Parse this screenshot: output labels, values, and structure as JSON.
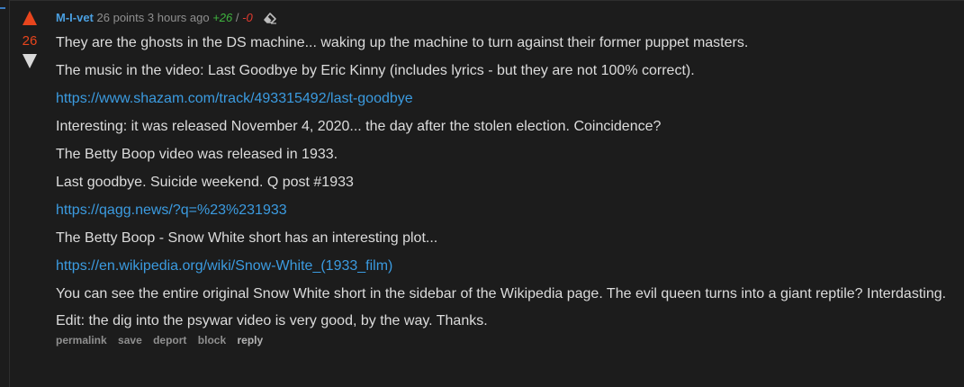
{
  "comment": {
    "author": "M-I-vet",
    "points": "26 points",
    "time": "3 hours ago",
    "upvotes": "+26",
    "separator": "/",
    "downvotes": "-0",
    "score": "26",
    "paragraphs": {
      "p1": "They are the ghosts in the DS machine... waking up the machine to turn against their former puppet masters.",
      "p2": "The music in the video: Last Goodbye by Eric Kinny (includes lyrics - but they are not 100% correct).",
      "link1": "https://www.shazam.com/track/493315492/last-goodbye",
      "p3": "Interesting: it was released November 4, 2020... the day after the stolen election. Coincidence?",
      "p4": "The Betty Boop video was released in 1933.",
      "p5": "Last goodbye. Suicide weekend. Q post #1933",
      "link2": "https://qagg.news/?q=%23%231933",
      "p6": "The Betty Boop - Snow White short has an interesting plot...",
      "link3": "https://en.wikipedia.org/wiki/Snow-White_(1933_film)",
      "p7": "You can see the entire original Snow White short in the sidebar of the Wikipedia page. The evil queen turns into a giant reptile? Interdasting.",
      "p8": "Edit: the dig into the psywar video is very good, by the way. Thanks."
    },
    "buttons": {
      "permalink": "permalink",
      "save": "save",
      "deport": "deport",
      "block": "block",
      "reply": "reply"
    }
  },
  "colors": {
    "background": "#1c1c1c",
    "upvote": "#e8451d",
    "author": "#4a9fe0",
    "link": "#3b9be0",
    "positive": "#3fb43f",
    "negative": "#e13b2f"
  },
  "icons": {
    "upvote": "upvote-arrow-icon",
    "downvote": "downvote-arrow-icon",
    "eraser": "eraser-icon"
  }
}
